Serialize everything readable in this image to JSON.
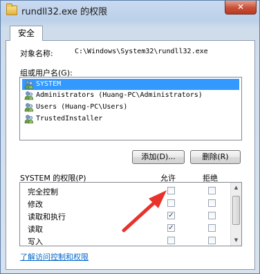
{
  "window": {
    "title": "rundll32.exe 的权限",
    "close_glyph": "✕"
  },
  "tabs": [
    {
      "label": "安全"
    }
  ],
  "object": {
    "label": "对象名称:",
    "value": "C:\\Windows\\System32\\rundll32.exe"
  },
  "groups": {
    "label": "组或用户名(G):",
    "items": [
      {
        "label": "SYSTEM",
        "icon": "users-icon",
        "selected": true
      },
      {
        "label": "Administrators (Huang-PC\\Administrators)",
        "icon": "users-icon",
        "selected": false
      },
      {
        "label": "Users (Huang-PC\\Users)",
        "icon": "users-icon",
        "selected": false
      },
      {
        "label": "TrustedInstaller",
        "icon": "users-icon",
        "selected": false
      }
    ]
  },
  "buttons": {
    "add": "添加(D)...",
    "remove": "删除(R)"
  },
  "permissions": {
    "header": "SYSTEM 的权限(P)",
    "allow_label": "允许",
    "deny_label": "拒绝",
    "check_glyph": "✓",
    "rows": [
      {
        "name": "完全控制",
        "allow": false,
        "deny": false
      },
      {
        "name": "修改",
        "allow": false,
        "deny": false
      },
      {
        "name": "读取和执行",
        "allow": true,
        "deny": false
      },
      {
        "name": "读取",
        "allow": true,
        "deny": false
      },
      {
        "name": "写入",
        "allow": false,
        "deny": false
      }
    ]
  },
  "help_link": "了解访问控制和权限",
  "colors": {
    "selection": "#3399ff",
    "link": "#0066cc",
    "annotation_arrow": "#e8322c"
  }
}
